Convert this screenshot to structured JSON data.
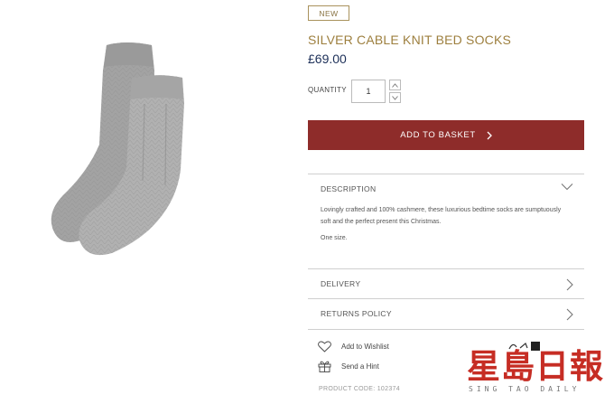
{
  "product": {
    "badge": "NEW",
    "title": "SILVER CABLE KNIT BED SOCKS",
    "price": "£69.00",
    "image_alt": "grey-cable-knit-socks"
  },
  "quantity": {
    "label": "QUANTITY",
    "value": "1"
  },
  "basket": {
    "label": "ADD TO BASKET",
    "icon": "chevron-right-icon"
  },
  "sections": {
    "description": {
      "label": "DESCRIPTION",
      "paragraphs": [
        "Lovingly crafted and 100% cashmere, these luxurious bedtime socks are sumptuously soft and the perfect present this Christmas.",
        "One size."
      ]
    },
    "delivery": {
      "label": "DELIVERY"
    },
    "returns": {
      "label": "RETURNS POLICY"
    }
  },
  "actions": {
    "wishlist": "Add to Wishlist",
    "hint": "Send a Hint"
  },
  "product_code": "PRODUCT CODE: 102374",
  "watermark": {
    "chars": "星島日報",
    "sub": "SING TAO DAILY"
  },
  "colors": {
    "accent": "#8e2c2a",
    "title": "#9d7f3e",
    "price": "#1c2f58",
    "watermark": "#c62d24"
  }
}
